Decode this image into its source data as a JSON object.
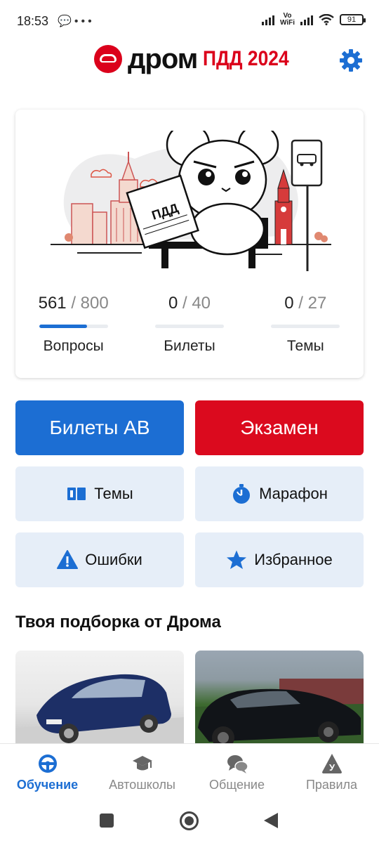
{
  "status_bar": {
    "time": "18:53",
    "left_icons": [
      "chat-bubble-icon",
      "more-dots-icon"
    ],
    "vo_wifi": "Vo\nWiFi",
    "battery": "91"
  },
  "app_bar": {
    "logo_drom": "дром",
    "logo_pdd": "ПДД 2024",
    "settings_icon": "gear-icon"
  },
  "illustration": {
    "book_text": "ПДД"
  },
  "progress": {
    "items": [
      {
        "done": "561",
        "separator": " / ",
        "total": "800",
        "label": "Вопросы",
        "fraction": 0.70125
      },
      {
        "done": "0",
        "separator": " / ",
        "total": "40",
        "label": "Билеты",
        "fraction": 0
      },
      {
        "done": "0",
        "separator": " / ",
        "total": "27",
        "label": "Темы",
        "fraction": 0
      }
    ]
  },
  "actions": {
    "tickets": "Билеты AB",
    "exam": "Экзамен",
    "topics": "Темы",
    "marathon": "Марафон",
    "errors": "Ошибки",
    "favorites": "Избранное"
  },
  "recommendations": {
    "title": "Твоя подборка от Дрома"
  },
  "bottom_nav": {
    "items": [
      {
        "label": "Обучение",
        "icon": "steering-wheel-icon",
        "active": true
      },
      {
        "label": "Автошколы",
        "icon": "graduation-cap-icon",
        "active": false
      },
      {
        "label": "Общение",
        "icon": "chat-bubbles-icon",
        "active": false
      },
      {
        "label": "Правила",
        "icon": "road-sign-icon",
        "active": false
      }
    ],
    "rules_sign_letter": "У"
  },
  "colors": {
    "accent_blue": "#1c6ed3",
    "exam_red": "#db0a1e",
    "brand_red": "#db001b",
    "light_button": "#e6eef8"
  }
}
